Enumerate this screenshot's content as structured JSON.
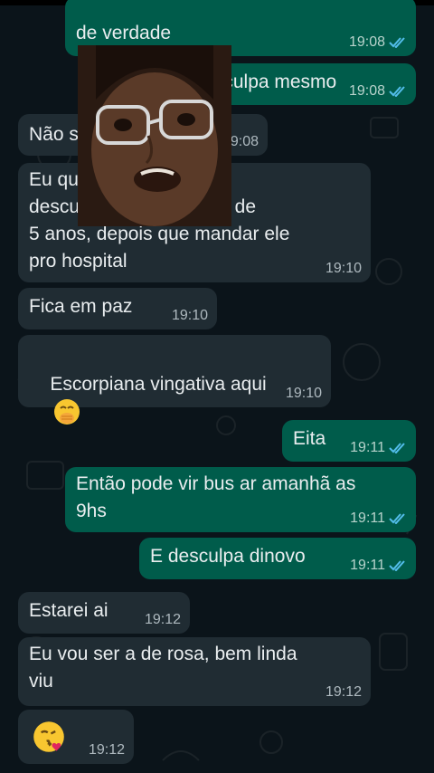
{
  "colors": {
    "incoming": "#202c33",
    "outgoing": "#005c4b",
    "background": "#0b141a",
    "read_ticks": "#53bdeb"
  },
  "messages": [
    {
      "dir": "out",
      "lines": "de verdade",
      "time": "19:08",
      "status": "read"
    },
    {
      "dir": "out",
      "lines": "Desculpa mesmo",
      "time": "19:08",
      "status": "read"
    },
    {
      "dir": "in",
      "lines": "Não s...",
      "time": "19:08"
    },
    {
      "dir": "in",
      "lines": "Eu quero te pedir\ndesculpas ao maridinho de\n5 anos, depois que mandar ele\npro hospital",
      "time": "19:10"
    },
    {
      "dir": "in",
      "lines": "Fica em paz",
      "time": "19:10"
    },
    {
      "dir": "in",
      "lines": "Escorpiana vingativa aqui",
      "time": "19:10",
      "emoji": "hand-over-mouth-emoji"
    },
    {
      "dir": "out",
      "lines": "Eita",
      "time": "19:11",
      "status": "read"
    },
    {
      "dir": "out",
      "lines": "Então pode vir bus ar amanhã as\n9hs",
      "time": "19:11",
      "status": "read"
    },
    {
      "dir": "out",
      "lines": "E desculpa dinovo",
      "time": "19:11",
      "status": "read"
    },
    {
      "dir": "in",
      "lines": "Estarei ai",
      "time": "19:12"
    },
    {
      "dir": "in",
      "lines": "Eu vou ser a de rosa, bem linda\nviu",
      "time": "19:12"
    },
    {
      "dir": "in",
      "lines": "",
      "time": "19:12",
      "emoji": "kissing-emoji"
    }
  ]
}
